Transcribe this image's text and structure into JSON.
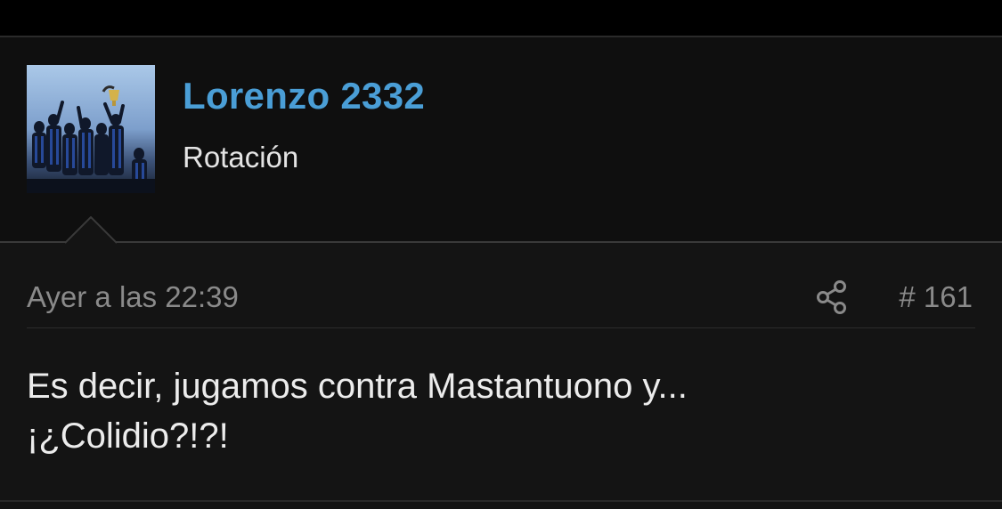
{
  "post": {
    "author": {
      "name": "Lorenzo 2332",
      "title": "Rotación",
      "avatar": "trophy-celebration-photo"
    },
    "timestamp": "Ayer a las 22:39",
    "number": "# 161",
    "share_icon": "share-icon",
    "body": [
      "Es decir, jugamos contra Mastantuono y...",
      "¡¿Colidio?!?!"
    ]
  },
  "colors": {
    "username": "#4a9ed6",
    "background": "#141414",
    "muted_text": "#8a8a8a"
  }
}
